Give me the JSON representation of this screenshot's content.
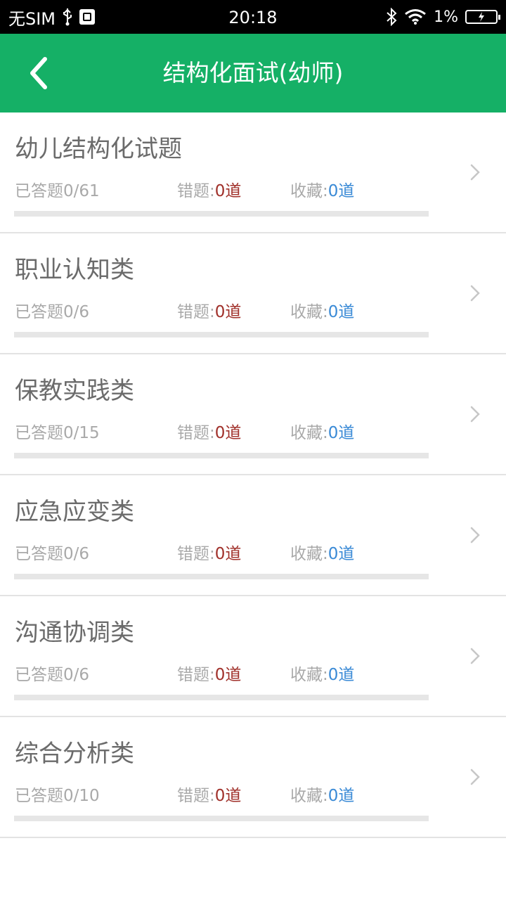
{
  "status_bar": {
    "carrier": "无SIM",
    "time": "20:18",
    "battery_pct": "1%",
    "icons": [
      "usb-icon",
      "notification-icon",
      "bluetooth-icon",
      "wifi-icon",
      "battery-icon"
    ]
  },
  "header": {
    "title": "结构化面试(幼师)",
    "back_icon": "chevron-left-icon",
    "background": "#15b066"
  },
  "colors": {
    "wrong_value": "#a0302a",
    "favorite_value": "#3a8ad6"
  },
  "labels": {
    "answered": "已答题",
    "wrong": "错题:",
    "favorite": "收藏:"
  },
  "items": [
    {
      "title": "幼儿结构化试题",
      "answered": "0/61",
      "wrong": "0道",
      "favorites": "0道",
      "progress": 0
    },
    {
      "title": "职业认知类",
      "answered": "0/6",
      "wrong": "0道",
      "favorites": "0道",
      "progress": 0
    },
    {
      "title": "保教实践类",
      "answered": "0/15",
      "wrong": "0道",
      "favorites": "0道",
      "progress": 0
    },
    {
      "title": "应急应变类",
      "answered": "0/6",
      "wrong": "0道",
      "favorites": "0道",
      "progress": 0
    },
    {
      "title": "沟通协调类",
      "answered": "0/6",
      "wrong": "0道",
      "favorites": "0道",
      "progress": 0
    },
    {
      "title": "综合分析类",
      "answered": "0/10",
      "wrong": "0道",
      "favorites": "0道",
      "progress": 0
    }
  ]
}
